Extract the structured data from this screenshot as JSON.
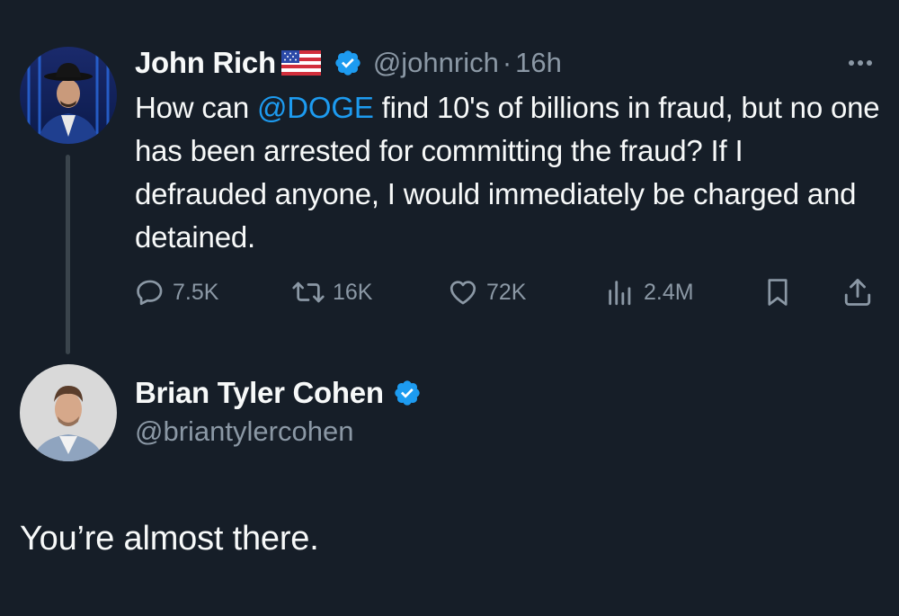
{
  "tweet": {
    "display_name": "John Rich",
    "flag_icon": "us-flag-icon",
    "handle": "@johnrich",
    "separator": "·",
    "time": "16h",
    "text_before": "How can ",
    "mention": "@DOGE",
    "text_after": " find 10's of billions in fraud, but no one has been arrested for committing the fraud? If I defrauded anyone, I would immediately be charged and detained.",
    "stats": {
      "replies": "7.5K",
      "reposts": "16K",
      "likes": "72K",
      "views": "2.4M"
    }
  },
  "reply": {
    "display_name": "Brian Tyler Cohen",
    "handle": "@briantylercohen",
    "text": "You’re almost there."
  },
  "colors": {
    "background": "#161e28",
    "text": "#f7f9f9",
    "muted": "#8b98a5",
    "accent": "#1d9bf0",
    "thread_line": "#3a444c"
  }
}
